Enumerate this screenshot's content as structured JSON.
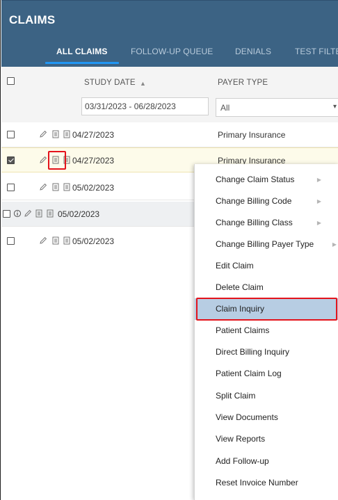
{
  "header": {
    "title": "CLAIMS",
    "tabs": [
      {
        "label": "ALL CLAIMS",
        "active": true
      },
      {
        "label": "FOLLOW-UP QUEUE",
        "active": false
      },
      {
        "label": "DENIALS",
        "active": false
      },
      {
        "label": "TEST FILTE",
        "active": false
      }
    ]
  },
  "columns": {
    "study_date": {
      "label": "STUDY DATE",
      "filter_value": "03/31/2023 - 06/28/2023"
    },
    "payer_type": {
      "label": "PAYER TYPE",
      "filter_value": "All"
    }
  },
  "rows": [
    {
      "study_date": "04/27/2023",
      "payer_type": "Primary Insurance",
      "checked": false
    },
    {
      "study_date": "04/27/2023",
      "payer_type": "Primary Insurance",
      "checked": true
    },
    {
      "study_date": "05/02/2023",
      "payer_type": "",
      "checked": false
    },
    {
      "study_date": "05/02/2023",
      "payer_type": "",
      "checked": false
    },
    {
      "study_date": "05/02/2023",
      "payer_type": "",
      "checked": false
    }
  ],
  "context_menu": {
    "items": [
      {
        "label": "Change Claim Status",
        "has_submenu": true
      },
      {
        "label": "Change Billing Code",
        "has_submenu": true
      },
      {
        "label": "Change Billing Class",
        "has_submenu": true
      },
      {
        "label": "Change Billing Payer Type",
        "has_submenu": true
      },
      {
        "label": "Edit Claim",
        "has_submenu": false
      },
      {
        "label": "Delete Claim",
        "has_submenu": false
      },
      {
        "label": "Claim Inquiry",
        "has_submenu": false,
        "active": true
      },
      {
        "label": "Patient Claims",
        "has_submenu": false
      },
      {
        "label": "Direct Billing Inquiry",
        "has_submenu": false
      },
      {
        "label": "Patient Claim Log",
        "has_submenu": false
      },
      {
        "label": "Split Claim",
        "has_submenu": false
      },
      {
        "label": "View Documents",
        "has_submenu": false
      },
      {
        "label": "View Reports",
        "has_submenu": false
      },
      {
        "label": "Add Follow-up",
        "has_submenu": false
      },
      {
        "label": "Reset Invoice Number",
        "has_submenu": false
      }
    ]
  },
  "icons": {
    "edit": "pencil-icon",
    "document": "document-icon",
    "info": "info-icon",
    "sort": "sort-ascending-icon",
    "dropdown": "chevron-down-icon",
    "submenu": "chevron-right-icon"
  },
  "colors": {
    "header_bg": "#3c6384",
    "tab_underline": "#2196f3",
    "selected_row_bg": "#fdfbea",
    "menu_active_bg": "#b7cde3",
    "callout_red": "#e4131b"
  }
}
